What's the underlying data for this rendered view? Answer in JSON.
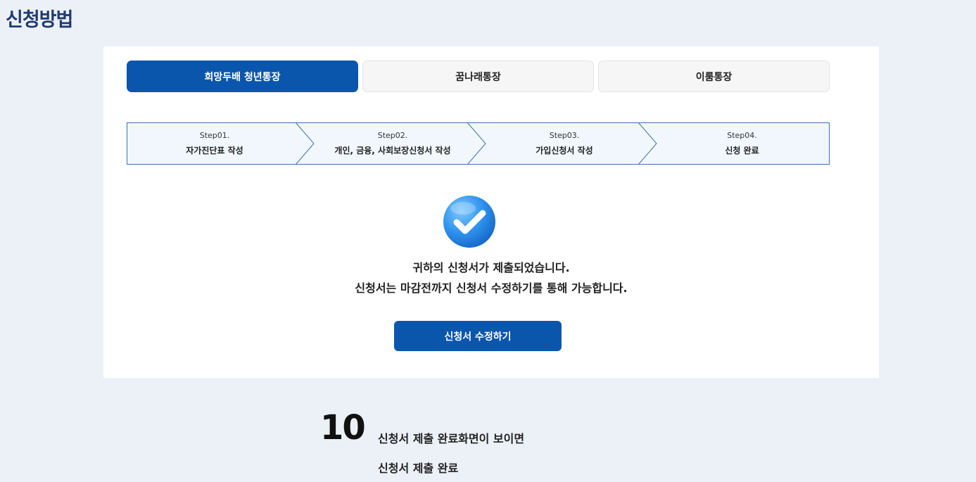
{
  "section_title": "신청방법",
  "tabs": [
    {
      "label": "희망두배 청년통장",
      "active": true
    },
    {
      "label": "꿈나래통장",
      "active": false
    },
    {
      "label": "이룸통장",
      "active": false
    }
  ],
  "steps": [
    {
      "number": "Step01.",
      "label": "자가진단표 작성"
    },
    {
      "number": "Step02.",
      "label": "개인, 금융, 사회보장신청서 작성"
    },
    {
      "number": "Step03.",
      "label": "가입신청서 작성"
    },
    {
      "number": "Step04.",
      "label": "신청 완료"
    }
  ],
  "message": {
    "line1": "귀하의 신청서가 제출되었습니다.",
    "line2": "신청서는 마감전까지 신청서 수정하기를 통해 가능합니다."
  },
  "edit_button_label": "신청서 수정하기",
  "caption": {
    "number": "10",
    "line1": "신청서 제출 완료화면이 보이면",
    "line2": "신청서 제출 완료"
  },
  "colors": {
    "primary": "#0b56ad",
    "step_bg": "#f1f7fd",
    "step_border": "#3f6fb5",
    "title": "#1e3a72"
  },
  "icons": {
    "check": "check-circle-icon"
  }
}
